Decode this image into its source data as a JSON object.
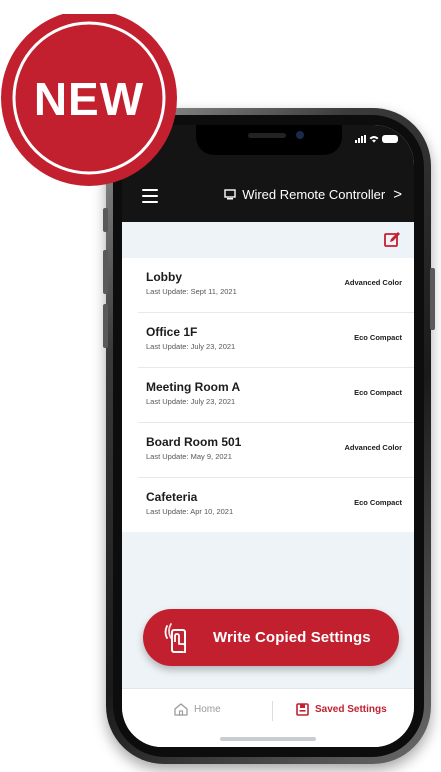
{
  "header": {
    "title": "Wired Remote Controller",
    "title_icon": "controller-icon",
    "chevron": ">"
  },
  "badge": {
    "text": "NEW",
    "color": "#c2202f"
  },
  "settings_list": [
    {
      "name": "Lobby",
      "updated": "Last Update: Sept 11, 2021",
      "model": "Advanced Color"
    },
    {
      "name": "Office 1F",
      "updated": "Last Update: July 23, 2021",
      "model": "Eco Compact"
    },
    {
      "name": "Meeting Room A",
      "updated": "Last Update: July 23, 2021",
      "model": "Eco Compact"
    },
    {
      "name": "Board Room 501",
      "updated": "Last Update: May 9, 2021",
      "model": "Advanced Color"
    },
    {
      "name": "Cafeteria",
      "updated": "Last Update: Apr 10, 2021",
      "model": "Eco Compact"
    }
  ],
  "action": {
    "write_label": "Write Copied Settings",
    "icon": "phone-tap-icon"
  },
  "bottom_nav": {
    "home_label": "Home",
    "saved_label": "Saved Settings",
    "active": "Saved Settings"
  },
  "colors": {
    "accent": "#c2202f",
    "header_bg": "#141414",
    "screen_bg": "#eef3f7"
  }
}
